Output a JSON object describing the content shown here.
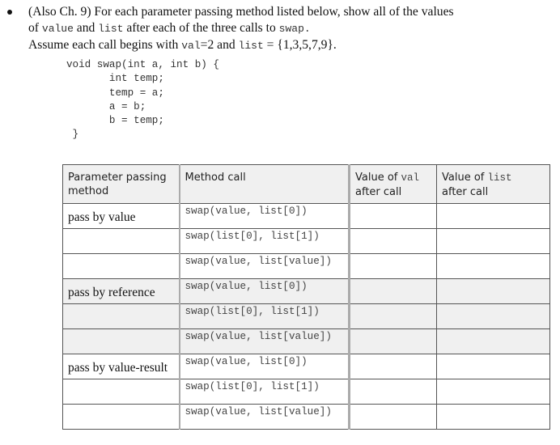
{
  "question": {
    "bullet_icon": "bullet",
    "line1": "(Also Ch. 9) For each parameter passing method listed below, show all of the values",
    "line2_pre": "of ",
    "line2_code1": "value",
    "line2_mid": " and ",
    "line2_code2": "list",
    "line2_post": " after each of the three calls to ",
    "line2_code3": "swap",
    "line2_end": ".",
    "line3_pre": "Assume each call begins with ",
    "line3_code1": "val",
    "line3_mid": "=2 and ",
    "line3_code2": "list",
    "line3_post": " = {1,3,5,7,9}."
  },
  "code": {
    "lines": [
      "void swap(int a, int b) {",
      "       int temp;",
      "       temp = a;",
      "       a = b;",
      "       b = temp;",
      " }"
    ]
  },
  "table": {
    "headers": {
      "method": "Parameter passing method",
      "call": "Method call",
      "val_pre": "Value of ",
      "val_code": "val",
      "val_post": "after call",
      "list_pre": "Value of ",
      "list_code": "list",
      "list_post": "after call"
    },
    "rows": [
      {
        "method": "pass by value",
        "call": "swap(value, list[0])",
        "val": "",
        "list": ""
      },
      {
        "method": "",
        "call": "swap(list[0], list[1])",
        "val": "",
        "list": ""
      },
      {
        "method": "",
        "call": "swap(value, list[value])",
        "val": "",
        "list": ""
      },
      {
        "method": "pass by reference",
        "call": "swap(value, list[0])",
        "val": "",
        "list": ""
      },
      {
        "method": "",
        "call": "swap(list[0], list[1])",
        "val": "",
        "list": ""
      },
      {
        "method": "",
        "call": "swap(value, list[value])",
        "val": "",
        "list": ""
      },
      {
        "method": "pass by value-result",
        "call": "swap(value, list[0])",
        "val": "",
        "list": ""
      },
      {
        "method": "",
        "call": "swap(list[0], list[1])",
        "val": "",
        "list": ""
      },
      {
        "method": "",
        "call": "swap(value, list[value])",
        "val": "",
        "list": ""
      }
    ]
  }
}
